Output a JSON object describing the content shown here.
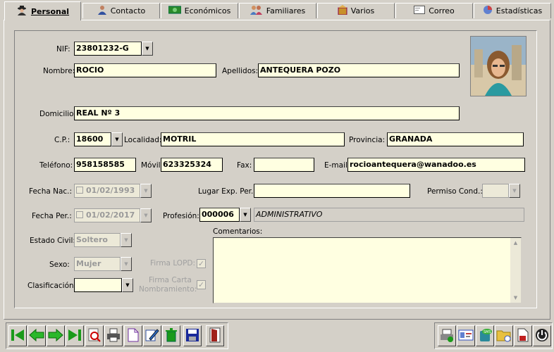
{
  "tabs": [
    {
      "label": "Personal",
      "icon": "person-icon"
    },
    {
      "label": "Contacto",
      "icon": "contact-icon"
    },
    {
      "label": "Económicos",
      "icon": "money-icon"
    },
    {
      "label": "Familiares",
      "icon": "family-icon"
    },
    {
      "label": "Varios",
      "icon": "box-icon"
    },
    {
      "label": "Correo",
      "icon": "mail-icon"
    },
    {
      "label": "Estadísticas",
      "icon": "chart-icon"
    }
  ],
  "form": {
    "nif": {
      "label": "NIF:",
      "value": "23801232-G"
    },
    "nombre": {
      "label": "Nombre:",
      "value": "ROCIO"
    },
    "apellidos": {
      "label": "Apellidos:",
      "value": "ANTEQUERA POZO"
    },
    "domicilio": {
      "label": "Domicilio:",
      "value": "REAL Nº 3"
    },
    "cp": {
      "label": "C.P.:",
      "value": "18600"
    },
    "localidad": {
      "label": "Localidad:",
      "value": "MOTRIL"
    },
    "provincia": {
      "label": "Provincia:",
      "value": "GRANADA"
    },
    "telefono": {
      "label": "Teléfono:",
      "value": "958158585"
    },
    "movil": {
      "label": "Móvil:",
      "value": "623325324"
    },
    "fax": {
      "label": "Fax:",
      "value": ""
    },
    "email": {
      "label": "E-mail:",
      "value": "rocioantequera@wanadoo.es"
    },
    "fecha_nac": {
      "label": "Fecha Nac.:",
      "value": "01/02/1993"
    },
    "lugar_exp": {
      "label": "Lugar Exp. Per.",
      "value": ""
    },
    "permiso_cond": {
      "label": "Permiso Cond.:",
      "value": ""
    },
    "fecha_per": {
      "label": "Fecha Per.:",
      "value": "01/02/2017"
    },
    "profesion": {
      "label": "Profesión:",
      "code": "000006",
      "desc": "ADMINISTRATIVO"
    },
    "estado_civil": {
      "label": "Estado Civil:",
      "value": "Soltero"
    },
    "comentarios": {
      "label": "Comentarios:",
      "value": ""
    },
    "sexo": {
      "label": "Sexo:",
      "value": "Mujer"
    },
    "firma_lopd": {
      "label": "Firma LOPD:",
      "checked": true
    },
    "clasificacion": {
      "label": "Clasificación:",
      "value": ""
    },
    "firma_carta": {
      "label1": "Firma Carta",
      "label2": "Nombramiento:",
      "checked": true
    }
  },
  "colors": {
    "field_bg": "#ffffe1",
    "window_bg": "#d4d0c8",
    "accent_green": "#1a9a1a"
  }
}
